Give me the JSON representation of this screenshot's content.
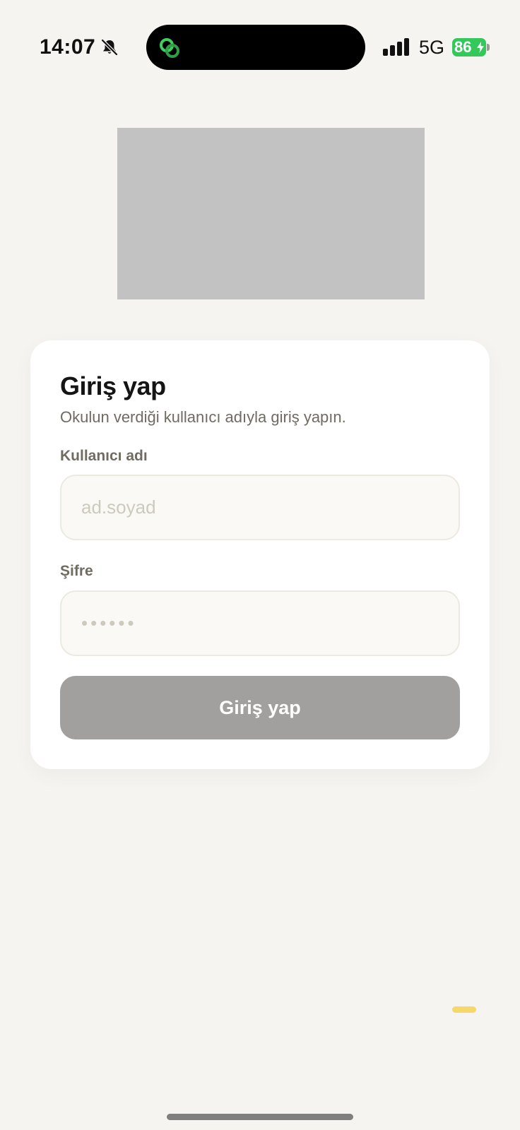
{
  "status_bar": {
    "time": "14:07",
    "network": "5G",
    "battery": "86",
    "battery_color": "#34c759"
  },
  "login_card": {
    "title": "Giriş yap",
    "subtitle": "Okulun verdiği kullanıcı adıyla giriş yapın.",
    "username_label": "Kullanıcı adı",
    "username_placeholder": "ad.soyad",
    "username_value": "",
    "password_label": "Şifre",
    "password_placeholder": "••••••",
    "password_value": "",
    "submit_label": "Giriş yap"
  },
  "colors": {
    "background": "#f5f4f0",
    "button_disabled": "#a1a09e",
    "input_background": "#faf9f5"
  },
  "icons": {
    "bell": "bell-slash-icon",
    "island_app": "link-rings-icon",
    "signal": "cellular-signal-icon",
    "battery": "battery-charging-icon"
  }
}
